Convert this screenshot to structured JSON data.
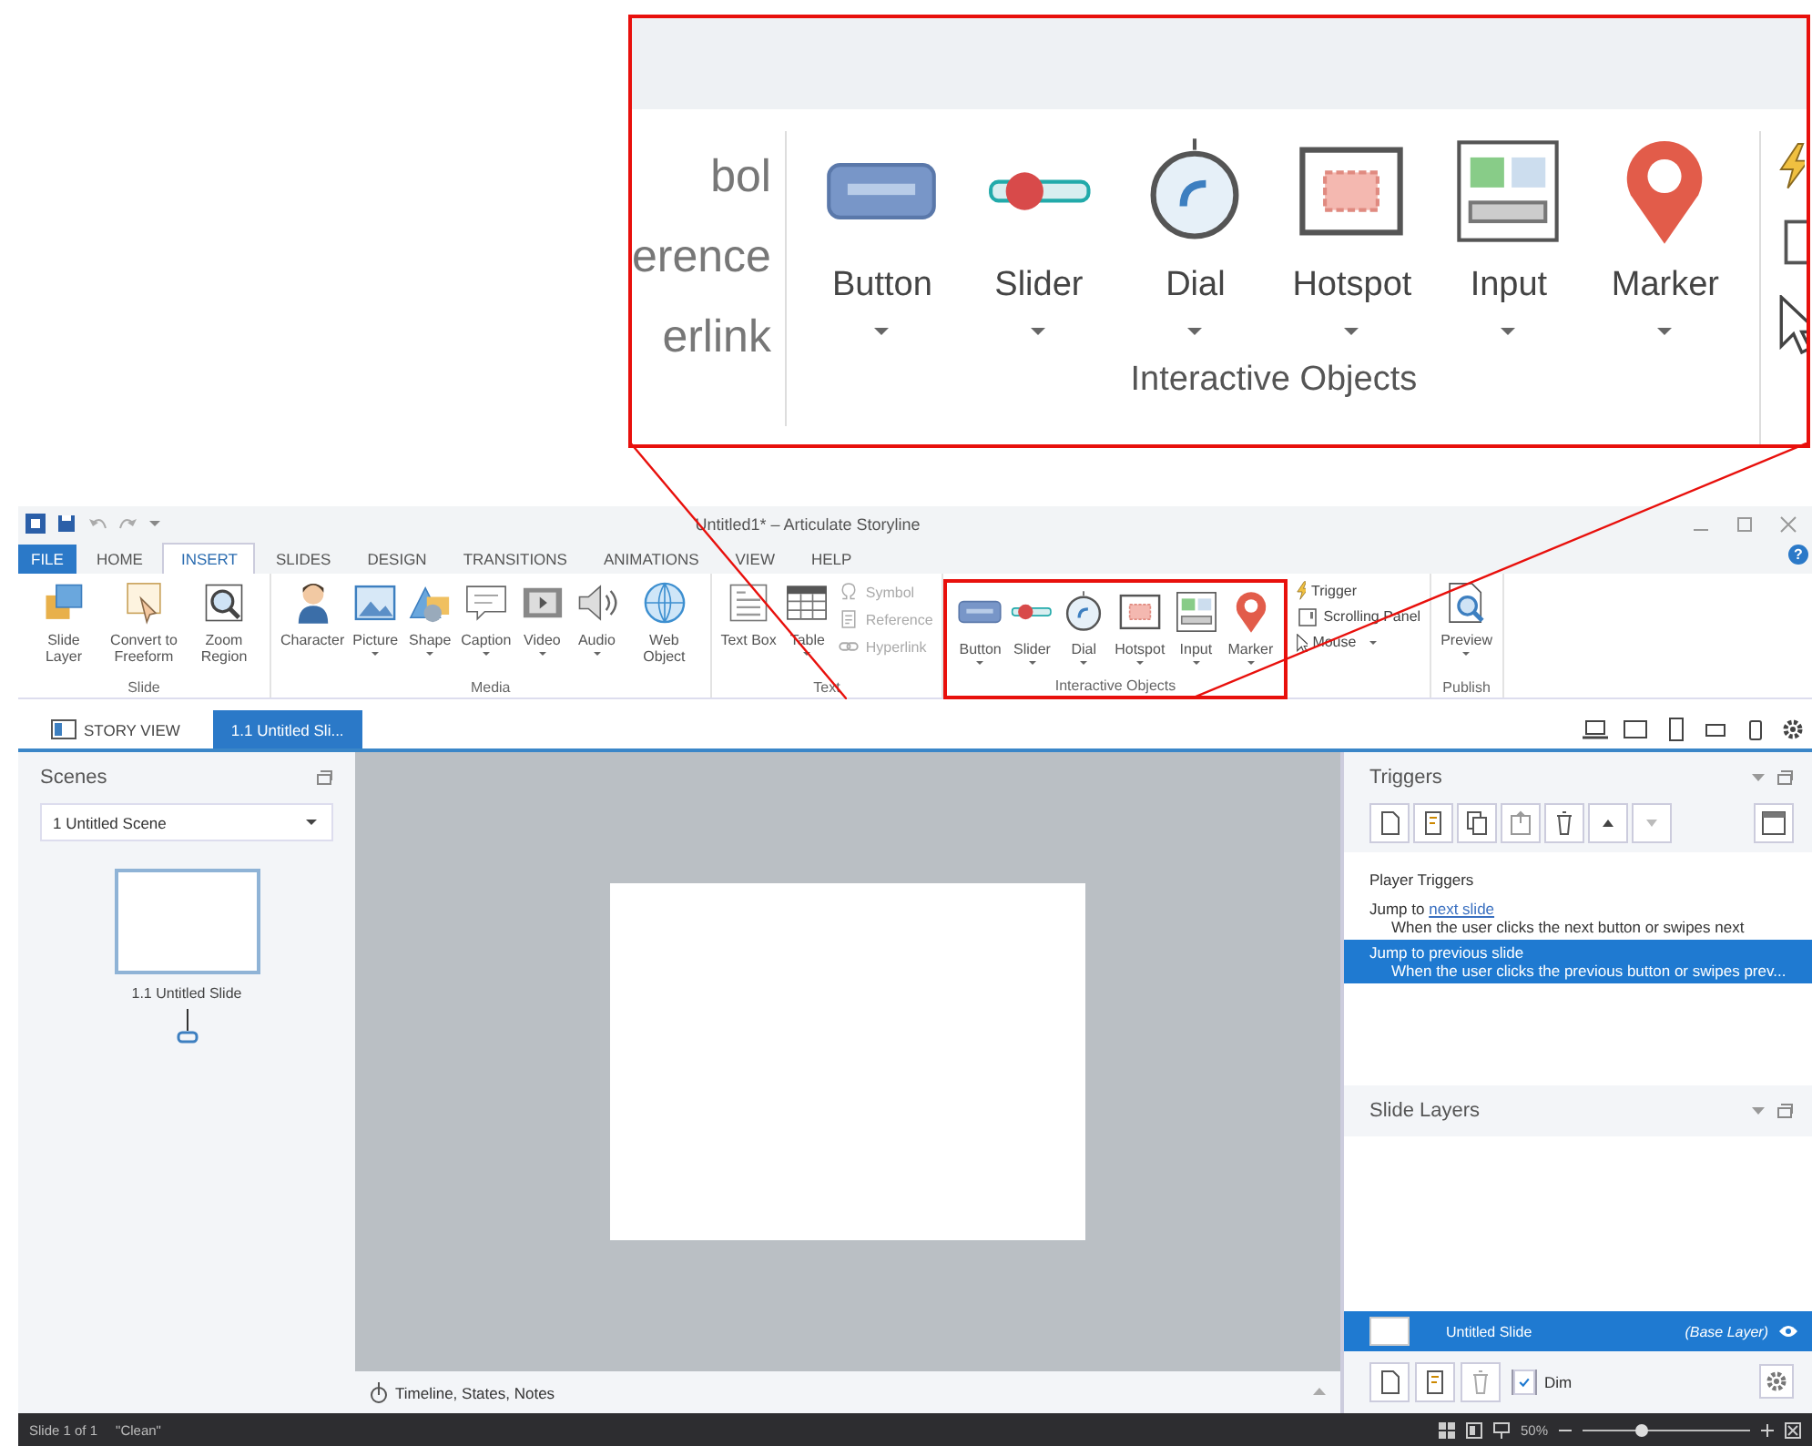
{
  "callout": {
    "cut_texts": [
      "bol",
      "erence",
      "erlink"
    ],
    "items": [
      {
        "label": "Button",
        "kind": "button",
        "dropdown": true
      },
      {
        "label": "Slider",
        "kind": "slider",
        "dropdown": true
      },
      {
        "label": "Dial",
        "kind": "dial",
        "dropdown": true
      },
      {
        "label": "Hotspot",
        "kind": "hotspot",
        "dropdown": true
      },
      {
        "label": "Input",
        "kind": "input",
        "dropdown": true
      },
      {
        "label": "Marker",
        "kind": "marker",
        "dropdown": true
      }
    ],
    "group_label": "Interactive Objects"
  },
  "window": {
    "title": "Untitled1* – Articulate Storyline",
    "help": "?"
  },
  "ribbon_tabs": [
    {
      "label": "FILE",
      "kind": "file",
      "selected": false
    },
    {
      "label": "HOME",
      "kind": "tab",
      "selected": false
    },
    {
      "label": "INSERT",
      "kind": "tab",
      "selected": true
    },
    {
      "label": "SLIDES",
      "kind": "tab",
      "selected": false
    },
    {
      "label": "DESIGN",
      "kind": "tab",
      "selected": false
    },
    {
      "label": "TRANSITIONS",
      "kind": "tab",
      "selected": false
    },
    {
      "label": "ANIMATIONS",
      "kind": "tab",
      "selected": false
    },
    {
      "label": "VIEW",
      "kind": "tab",
      "selected": false
    },
    {
      "label": "HELP",
      "kind": "tab",
      "selected": false
    }
  ],
  "ribbon_groups": [
    {
      "label": "Slide",
      "items": [
        {
          "label": "Slide Layer",
          "kind": "layer",
          "dropdown": false
        },
        {
          "label": "Convert to Freeform",
          "kind": "freeform",
          "dropdown": false
        },
        {
          "label": "Zoom Region",
          "kind": "zoom",
          "dropdown": false
        }
      ]
    },
    {
      "label": "Media",
      "items": [
        {
          "label": "Character",
          "kind": "character",
          "dropdown": false
        },
        {
          "label": "Picture",
          "kind": "picture",
          "dropdown": true
        },
        {
          "label": "Shape",
          "kind": "shape",
          "dropdown": true
        },
        {
          "label": "Caption",
          "kind": "caption",
          "dropdown": true
        },
        {
          "label": "Video",
          "kind": "video",
          "dropdown": true
        },
        {
          "label": "Audio",
          "kind": "audio",
          "dropdown": true
        },
        {
          "label": "Web Object",
          "kind": "web",
          "dropdown": false
        }
      ]
    },
    {
      "label": "Text",
      "items": [
        {
          "label": "Text Box",
          "kind": "textbox",
          "dropdown": false
        },
        {
          "label": "Table",
          "kind": "table",
          "dropdown": true
        }
      ],
      "small_items": [
        {
          "label": "Symbol",
          "kind": "symbol",
          "disabled": true,
          "dropdown": false
        },
        {
          "label": "Reference",
          "kind": "reference",
          "disabled": true,
          "dropdown": false
        },
        {
          "label": "Hyperlink",
          "kind": "hyperlink",
          "disabled": true,
          "dropdown": false
        }
      ]
    },
    {
      "label": "Interactive Objects",
      "highlighted": true,
      "items": [
        {
          "label": "Button",
          "kind": "button",
          "dropdown": true
        },
        {
          "label": "Slider",
          "kind": "slider",
          "dropdown": true
        },
        {
          "label": "Dial",
          "kind": "dial",
          "dropdown": true
        },
        {
          "label": "Hotspot",
          "kind": "hotspot",
          "dropdown": true
        },
        {
          "label": "Input",
          "kind": "input",
          "dropdown": true
        },
        {
          "label": "Marker",
          "kind": "marker",
          "dropdown": true
        }
      ]
    },
    {
      "small_items": [
        {
          "label": "Trigger",
          "kind": "trigger",
          "disabled": false,
          "dropdown": false
        },
        {
          "label": "Scrolling Panel",
          "kind": "scroll",
          "disabled": false,
          "dropdown": false
        },
        {
          "label": "Mouse",
          "kind": "mouse",
          "disabled": false,
          "dropdown": true
        }
      ]
    },
    {
      "label": "Publish",
      "items": [
        {
          "label": "Preview",
          "kind": "preview",
          "dropdown": true
        }
      ]
    }
  ],
  "doc_tabs": [
    {
      "label": "STORY VIEW",
      "kind": "story",
      "selected": false
    },
    {
      "label": "1.1 Untitled Sli...",
      "kind": "slide",
      "selected": true
    }
  ],
  "scenes": {
    "title": "Scenes",
    "scene": "1 Untitled Scene",
    "slides": [
      {
        "label": "1.1 Untitled Slide"
      }
    ]
  },
  "bottom_bar": {
    "label": "Timeline, States, Notes"
  },
  "triggers": {
    "title": "Triggers",
    "heading": "Player Triggers",
    "items": [
      {
        "action": "Jump to",
        "target": "next slide",
        "condition": "When the user clicks the next button or swipes next",
        "selected": false
      },
      {
        "action": "Jump to",
        "target": "previous slide",
        "condition": "When the user clicks the previous button or swipes prev...",
        "selected": true
      }
    ]
  },
  "layers": {
    "title": "Slide Layers",
    "items": [
      {
        "name": "Untitled Slide",
        "note": "(Base Layer)",
        "selected": true
      }
    ],
    "dim": {
      "label": "Dim",
      "checked": true
    }
  },
  "status_bar": {
    "slide": "Slide 1 of 1",
    "theme": "\"Clean\"",
    "zoom": "50%",
    "level": 0.35
  }
}
